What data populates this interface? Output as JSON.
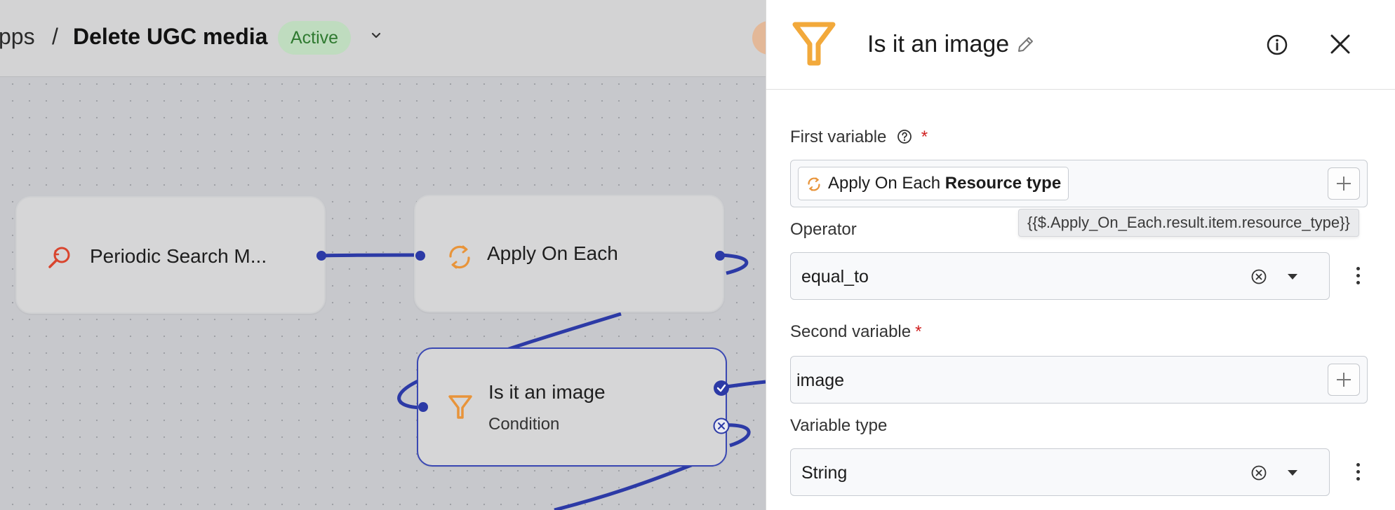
{
  "topbar": {
    "breadcrumb_parent": "pps",
    "breadcrumb_separator": "/",
    "workflow_title": "Delete UGC media",
    "status": "Active"
  },
  "nodes": {
    "periodic": {
      "label": "Periodic Search M...",
      "icon": "search-refresh-icon"
    },
    "apply": {
      "label": "Apply On Each",
      "icon": "loop-icon"
    },
    "condition": {
      "label": "Is it an image",
      "sublabel": "Condition",
      "icon": "filter-icon"
    }
  },
  "panel": {
    "title": "Is it an image",
    "icon": "filter-icon",
    "first_variable": {
      "label": "First variable",
      "required": "*",
      "chip_prefix": "Apply On Each",
      "chip_bold": "Resource type",
      "tooltip": "{{$.Apply_On_Each.result.item.resource_type}}"
    },
    "operator": {
      "label": "Operator",
      "value": "equal_to"
    },
    "second_variable": {
      "label": "Second variable",
      "required": "*",
      "value": "image"
    },
    "variable_type": {
      "label": "Variable type",
      "value": "String"
    }
  },
  "colors": {
    "accent": "#2c3aa6",
    "condition_icon": "#f2a93b",
    "search_icon": "#d9452e",
    "status_bg": "#bfdcbf",
    "status_text": "#2f7a30"
  }
}
